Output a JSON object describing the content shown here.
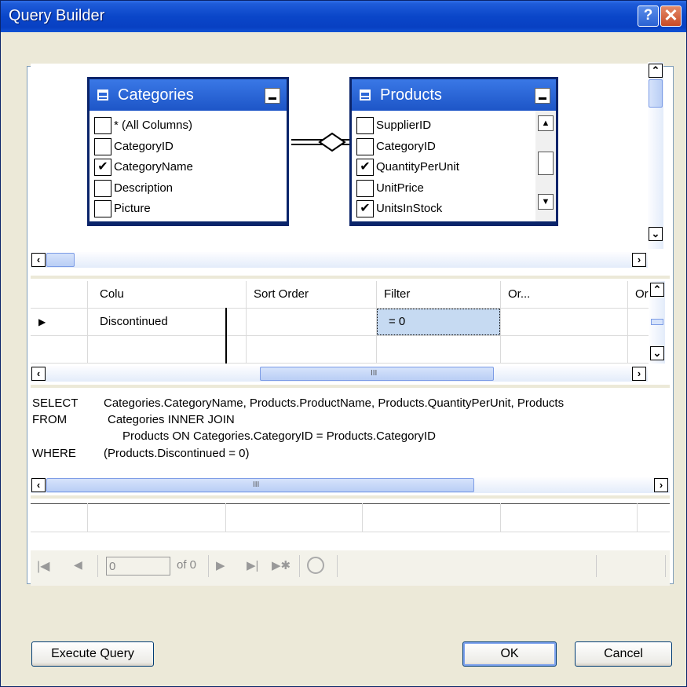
{
  "window": {
    "title": "Query Builder",
    "help_label": "?",
    "close_label": "✕"
  },
  "diagram": {
    "tables": [
      {
        "name": "Categories",
        "icon": "table-icon",
        "columns": [
          {
            "label": "* (All Columns)",
            "checked": false
          },
          {
            "label": "CategoryID",
            "checked": false
          },
          {
            "label": "CategoryName",
            "checked": true
          },
          {
            "label": "Description",
            "checked": false
          },
          {
            "label": "Picture",
            "checked": false
          }
        ]
      },
      {
        "name": "Products",
        "icon": "table-icon",
        "columns": [
          {
            "label": "SupplierID",
            "checked": false
          },
          {
            "label": "CategoryID",
            "checked": false
          },
          {
            "label": "QuantityPerUnit",
            "checked": true
          },
          {
            "label": "UnitPrice",
            "checked": false
          },
          {
            "label": "UnitsInStock",
            "checked": true
          }
        ]
      }
    ]
  },
  "grid": {
    "headers": [
      "Colu",
      "Sort Order",
      "Filter",
      "Or...",
      "Or"
    ],
    "rows": [
      {
        "column": "Discontinued",
        "sort_order": "",
        "filter": "= 0",
        "or1": "",
        "or2": ""
      },
      {
        "column": "",
        "sort_order": "",
        "filter": "",
        "or1": "",
        "or2": ""
      }
    ]
  },
  "sql": {
    "lines": [
      {
        "keyword": "SELECT",
        "text": "Categories.CategoryName, Products.ProductName, Products.QuantityPerUnit, Products"
      },
      {
        "keyword": "FROM",
        "text": "Categories INNER JOIN"
      },
      {
        "keyword": "",
        "text": "Products ON Categories.CategoryID = Products.CategoryID"
      },
      {
        "keyword": "WHERE",
        "text": "(Products.Discontinued = 0)"
      }
    ]
  },
  "navigator": {
    "position": "0",
    "of_label": "of 0"
  },
  "buttons": {
    "execute": "Execute Query",
    "ok": "OK",
    "cancel": "Cancel"
  }
}
